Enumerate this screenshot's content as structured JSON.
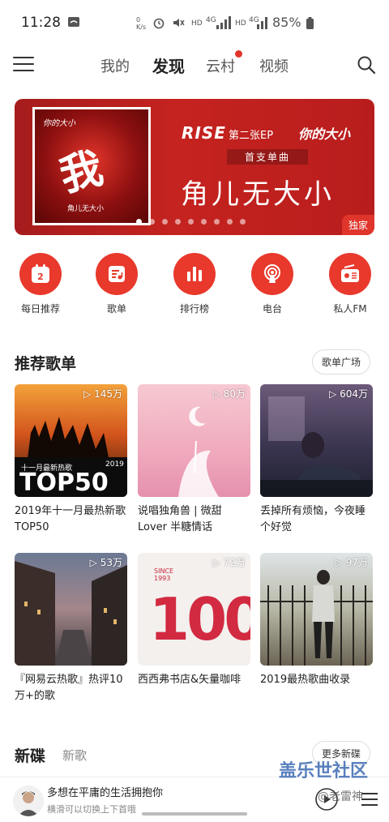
{
  "status_bar": {
    "time": "11:28",
    "speed": "0 K/s",
    "net1": "4G",
    "hd1": "HD",
    "hd2": "HD",
    "net2": "4G",
    "battery": "85%"
  },
  "nav": {
    "tabs": [
      {
        "label": "我的"
      },
      {
        "label": "发现"
      },
      {
        "label": "云村"
      },
      {
        "label": "视频"
      }
    ],
    "active_tab": "发现"
  },
  "banner": {
    "cover_text_top": "你的大小",
    "cover_big_char": "我",
    "cover_sub": "角儿无大小",
    "brand": "RISE",
    "ep_label": "第二张EP",
    "ep_name": "你的大小",
    "first_single": "首支单曲",
    "song": "角儿无大小",
    "badge": "独家",
    "dots_total": 9,
    "dots_active": 0
  },
  "quick_entries": [
    {
      "label": "每日推荐",
      "icon": "calendar-icon",
      "num": "2"
    },
    {
      "label": "歌单",
      "icon": "playlist-icon"
    },
    {
      "label": "排行榜",
      "icon": "ranking-icon"
    },
    {
      "label": "电台",
      "icon": "radio-icon"
    },
    {
      "label": "私人FM",
      "icon": "fm-icon"
    }
  ],
  "recommended": {
    "title": "推荐歌单",
    "more": "歌单广场",
    "items": [
      {
        "plays": "145万",
        "title": "2019年十一月最热新歌TOP50",
        "img_text1": "十一月最新热歌",
        "img_text2": "TOP50",
        "img_text3": "2019"
      },
      {
        "plays": "80万",
        "title": "说唱独角兽 | 微甜Lover 半糖情话"
      },
      {
        "plays": "604万",
        "title": "丢掉所有烦恼，今夜睡个好觉"
      },
      {
        "plays": "53万",
        "title": "『网易云热歌』热评10万+的歌"
      },
      {
        "plays": "72万",
        "title": "西西弗书店&矢量咖啡",
        "img_text1": "SINCE 1993",
        "img_text2": "100"
      },
      {
        "plays": "97万",
        "title": "2019最热歌曲收录"
      }
    ]
  },
  "new_section": {
    "title": "新碟",
    "subtitle": "新歌",
    "more": "更多新碟"
  },
  "player": {
    "title": "多想在平庸的生活拥抱你",
    "hint": "横滑可以切换上下首哦"
  },
  "watermark": {
    "line1": "盖乐世社区",
    "line2": "@老雷神"
  }
}
